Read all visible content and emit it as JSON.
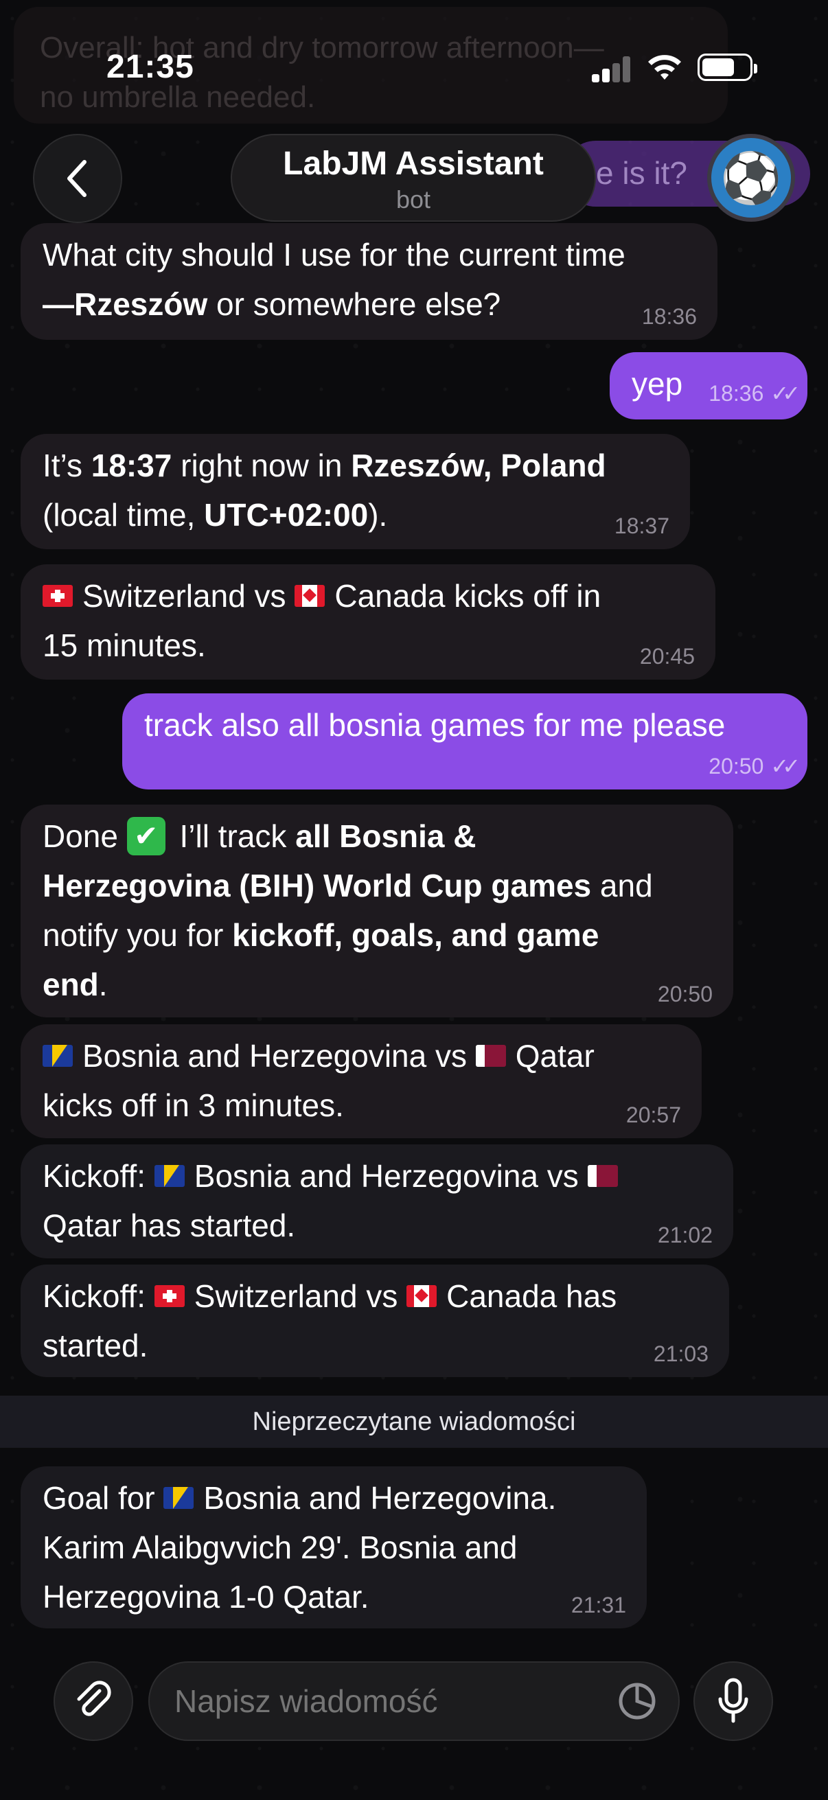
{
  "status_bar": {
    "time": "21:35"
  },
  "ghost": {
    "text_line1": "Overall: hot and dry tomorrow afternoon—",
    "text_line2": "no umbrella needed.",
    "right_text": "e is it?"
  },
  "header": {
    "title": "LabJM Assistant",
    "subtitle": "bot",
    "avatar_icon": "soccer-ball-icon",
    "avatar_emoji": "⚽"
  },
  "messages": [
    {
      "id": "m1",
      "direction": "in",
      "line1": "What city should I use for the current time",
      "line2_pre": "—",
      "line2_bold": "Rzeszów",
      "line2_post": " or somewhere else?",
      "time": "18:36"
    },
    {
      "id": "m2",
      "direction": "out",
      "text": "yep",
      "time": "18:36"
    },
    {
      "id": "m3",
      "direction": "in",
      "a": "It’s ",
      "b": "18:37",
      "c": " right now in ",
      "d": "Rzeszów, Poland",
      "e": "(local time, ",
      "f": "UTC+02:00",
      "g": ").",
      "time": "18:37"
    },
    {
      "id": "m4",
      "direction": "in",
      "team1": "Switzerland",
      "vs": " vs ",
      "team2": "Canada",
      "tail": " kicks off in",
      "line2": "15 minutes.",
      "time": "20:45"
    },
    {
      "id": "m5",
      "direction": "out",
      "text": "track also all bosnia games for me please",
      "time": "20:50"
    },
    {
      "id": "m6",
      "direction": "in",
      "a": "Done ",
      "check": "✔",
      "b": " I’ll track ",
      "c": "all Bosnia &",
      "d": "Herzegovina (BIH) World Cup games",
      "e": " and",
      "f": "notify you for ",
      "g": "kickoff, goals, and game",
      "h": "end",
      "i": ".",
      "time": "20:50"
    },
    {
      "id": "m7",
      "direction": "in",
      "team1": "Bosnia and Herzegovina",
      "vs": " vs ",
      "team2": "Qatar",
      "line2": "kicks off in 3 minutes.",
      "time": "20:57"
    },
    {
      "id": "m8",
      "direction": "in",
      "prefix": "Kickoff: ",
      "team1": "Bosnia and Herzegovina",
      "vs": " vs ",
      "team2": "Qatar",
      "tail": " has started.",
      "time": "21:02"
    },
    {
      "id": "m9",
      "direction": "in",
      "prefix": "Kickoff: ",
      "team1": "Switzerland",
      "vs": " vs ",
      "team2": "Canada",
      "tail": " has",
      "line2": "started.",
      "time": "21:03"
    },
    {
      "id": "m10",
      "direction": "in",
      "prefix": "Goal for ",
      "team1": "Bosnia and Herzegovina.",
      "line2": "Karim Alaibgvvich 29'. Bosnia and",
      "line3": "Herzegovina 1-0 Qatar.",
      "time": "21:31"
    }
  ],
  "unread_label": "Nieprzeczytane wiadomości",
  "composer": {
    "placeholder": "Napisz wiadomość",
    "attach_icon": "paperclip-icon",
    "sticker_icon": "sticker-icon",
    "mic_icon": "microphone-icon"
  },
  "colors": {
    "incoming_bubble": "#1e1a1f",
    "outgoing_bubble": "#8b4ce6",
    "background": "#0a0a0b"
  }
}
